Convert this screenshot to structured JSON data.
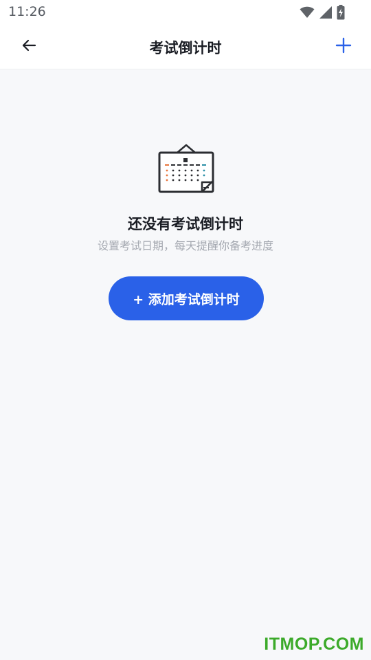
{
  "status_bar": {
    "time": "11:26",
    "icons": [
      "wifi-icon",
      "signal-icon",
      "battery-charging-icon"
    ]
  },
  "header": {
    "title": "考试倒计时",
    "back_icon": "arrow-left-icon",
    "add_icon": "plus-icon",
    "accent_color": "#2a61e8"
  },
  "empty_state": {
    "illustration": "calendar-icon",
    "title": "还没有考试倒计时",
    "subtitle": "设置考试日期，每天提醒你备考进度",
    "button_label": "+ 添加考试倒计时",
    "button_color": "#2a61e8"
  },
  "watermark": "ITMOP.COM"
}
